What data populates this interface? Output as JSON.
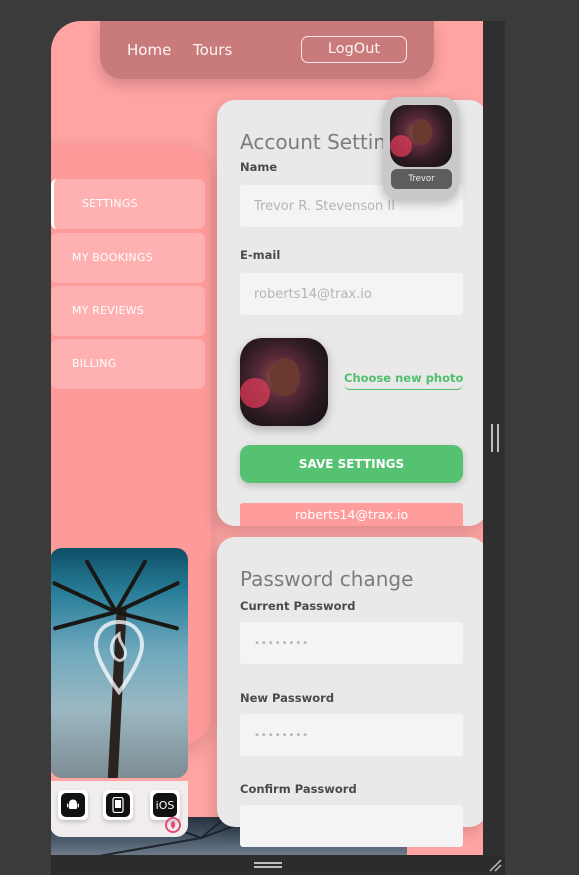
{
  "nav": {
    "home": "Home",
    "tours": "Tours",
    "logout": "LogOut"
  },
  "sidebar": {
    "items": [
      {
        "label": "SETTINGS",
        "active": true
      },
      {
        "label": "MY BOOKINGS",
        "active": false
      },
      {
        "label": "MY REVIEWS",
        "active": false
      },
      {
        "label": "BILLING",
        "active": false
      }
    ]
  },
  "promo": {
    "apps": [
      {
        "icon": "android-icon",
        "label": ""
      },
      {
        "icon": "phone-icon",
        "label": ""
      },
      {
        "icon": "ios-icon",
        "label": "iOS"
      }
    ]
  },
  "account": {
    "title": "Account Settings",
    "name_label": "Name",
    "name_value": "Trevor R. Stevenson II",
    "email_label": "E-mail",
    "email_value": "roberts14@trax.io",
    "choose_photo": "Choose new photo",
    "save": "SAVE SETTINGS",
    "email_bar": "roberts14@trax.io"
  },
  "avatar": {
    "name": "Trevor"
  },
  "password": {
    "title": "Password change",
    "current_label": "Current Password",
    "current_value": "••••••••",
    "new_label": "New Password",
    "new_value": "••••••••",
    "confirm_label": "Confirm Password"
  },
  "colors": {
    "accent_pink": "#ffa3a3",
    "nav_bg": "#c97b7b",
    "save_green": "#55c271",
    "card_bg": "#e9e9e9"
  }
}
